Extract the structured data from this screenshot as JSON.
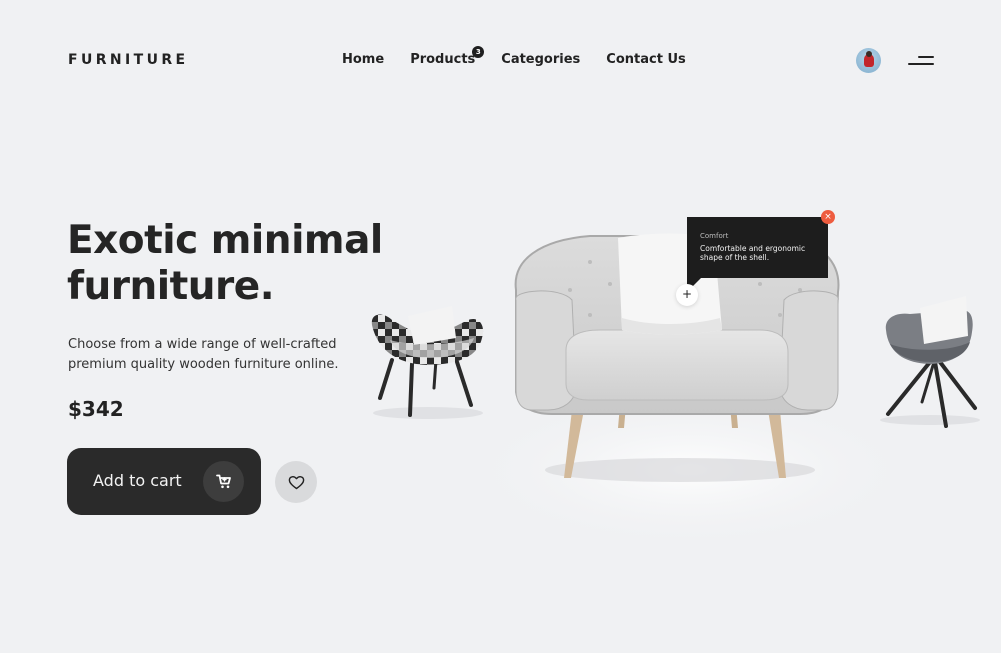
{
  "brand": {
    "logo": "FURNITURE"
  },
  "nav": {
    "items": [
      {
        "label": "Home"
      },
      {
        "label": "Products",
        "badge": "3"
      },
      {
        "label": "Categories"
      },
      {
        "label": "Contact Us"
      }
    ]
  },
  "hero": {
    "headline_line1": "Exotic minimal",
    "headline_line2": "furniture.",
    "description": "Choose from a wide range of well-crafted premium quality wooden furniture online.",
    "price": "$342",
    "add_to_cart_label": "Add to cart"
  },
  "tooltip": {
    "title": "Comfort",
    "text": "Comfortable and ergonomic shape of the shell.",
    "close_symbol": "×",
    "hotspot_symbol": "+"
  },
  "colors": {
    "background": "#f0f1f3",
    "button_dark": "#2a2a2a",
    "close_accent": "#ee5c3f"
  },
  "icons": {
    "cart": "cart-icon",
    "heart": "heart-icon",
    "menu": "menu-icon"
  }
}
